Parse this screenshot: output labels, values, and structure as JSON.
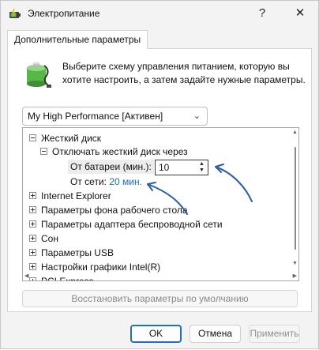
{
  "window": {
    "title": "Электропитание",
    "help_glyph": "?",
    "close_glyph": "✕"
  },
  "tab": {
    "label": "Дополнительные параметры"
  },
  "description": "Выберите схему управления питанием, которую вы хотите настроить, а затем задайте нужные параметры.",
  "plan_select": {
    "value": "My High Performance [Активен]"
  },
  "tree": {
    "hdd": {
      "label": "Жесткий диск",
      "turn_off": {
        "label": "Отключать жесткий диск через",
        "on_battery_label": "От батареи (мин.):",
        "on_battery_value": "10",
        "plugged_in_label": "От сети:",
        "plugged_in_value": "20 мин."
      }
    },
    "items": [
      "Internet Explorer",
      "Параметры фона рабочего стола",
      "Параметры адаптера беспроводной сети",
      "Сон",
      "Параметры USB",
      "Настройки графики Intel(R)",
      "PCI Express"
    ]
  },
  "restore_button": "Восстановить параметры по умолчанию",
  "buttons": {
    "ok": "OK",
    "cancel": "Отмена",
    "apply": "Применить"
  },
  "colors": {
    "accent": "#1f6fc5",
    "link": "#1a6dc4",
    "annotation_arrow": "#2a5da8"
  },
  "icons": [
    "power-options-icon",
    "battery-icon",
    "help-icon",
    "close-icon",
    "chevron-down-icon",
    "expand-icon",
    "collapse-icon"
  ]
}
